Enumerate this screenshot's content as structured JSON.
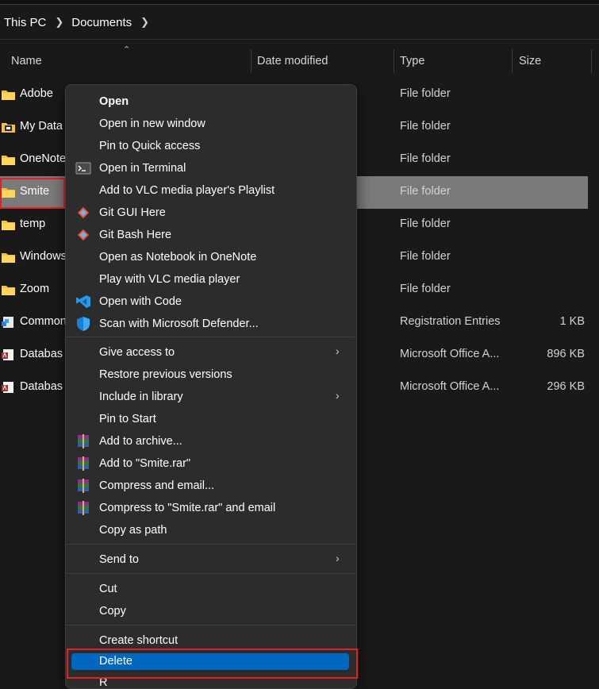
{
  "breadcrumb": {
    "items": [
      "This PC",
      "Documents"
    ]
  },
  "columns": {
    "name": "Name",
    "date_modified": "Date modified",
    "type": "Type",
    "size": "Size"
  },
  "rows": [
    {
      "name": "Adobe",
      "type": "File folder",
      "size": ""
    },
    {
      "name": "My Data",
      "type": "File folder",
      "size": ""
    },
    {
      "name": "OneNote",
      "type": "File folder",
      "size": ""
    },
    {
      "name": "Smite",
      "type": "File folder",
      "size": "",
      "selected": true
    },
    {
      "name": "temp",
      "type": "File folder",
      "size": ""
    },
    {
      "name": "Windows",
      "type": "File folder",
      "size": ""
    },
    {
      "name": "Zoom",
      "type": "File folder",
      "size": ""
    },
    {
      "name": "Common",
      "type": "Registration Entries",
      "size": "1 KB"
    },
    {
      "name": "Databas",
      "type": "Microsoft Office A...",
      "size": "896 KB"
    },
    {
      "name": "Databas",
      "type": "Microsoft Office A...",
      "size": "296 KB"
    }
  ],
  "context_menu": {
    "group1": [
      {
        "label": "Open",
        "bold": true
      },
      {
        "label": "Open in new window"
      },
      {
        "label": "Pin to Quick access"
      },
      {
        "label": "Open in Terminal",
        "icon": "terminal-icon"
      },
      {
        "label": "Add to VLC media player's Playlist"
      },
      {
        "label": "Git GUI Here",
        "icon": "git-icon"
      },
      {
        "label": "Git Bash Here",
        "icon": "git-icon"
      },
      {
        "label": "Open as Notebook in OneNote"
      },
      {
        "label": "Play with VLC media player"
      },
      {
        "label": "Open with Code",
        "icon": "vscode-icon"
      },
      {
        "label": "Scan with Microsoft Defender...",
        "icon": "defender-shield-icon"
      }
    ],
    "group2": [
      {
        "label": "Give access to",
        "submenu": true
      },
      {
        "label": "Restore previous versions"
      },
      {
        "label": "Include in library",
        "submenu": true
      },
      {
        "label": "Pin to Start"
      },
      {
        "label": "Add to archive...",
        "icon": "winrar-icon"
      },
      {
        "label": "Add to \"Smite.rar\"",
        "icon": "winrar-icon"
      },
      {
        "label": "Compress and email...",
        "icon": "winrar-icon"
      },
      {
        "label": "Compress to \"Smite.rar\" and email",
        "icon": "winrar-icon"
      },
      {
        "label": "Copy as path"
      }
    ],
    "group3": [
      {
        "label": "Send to",
        "submenu": true
      }
    ],
    "group4": [
      {
        "label": "Cut"
      },
      {
        "label": "Copy"
      }
    ],
    "group5": [
      {
        "label": "Create shortcut"
      },
      {
        "label": "Delete",
        "highlighted": true
      },
      {
        "label": "R"
      }
    ]
  },
  "colors": {
    "accent": "#0067c0",
    "highlight_box": "#e0212a",
    "folder": "#f4c242"
  }
}
